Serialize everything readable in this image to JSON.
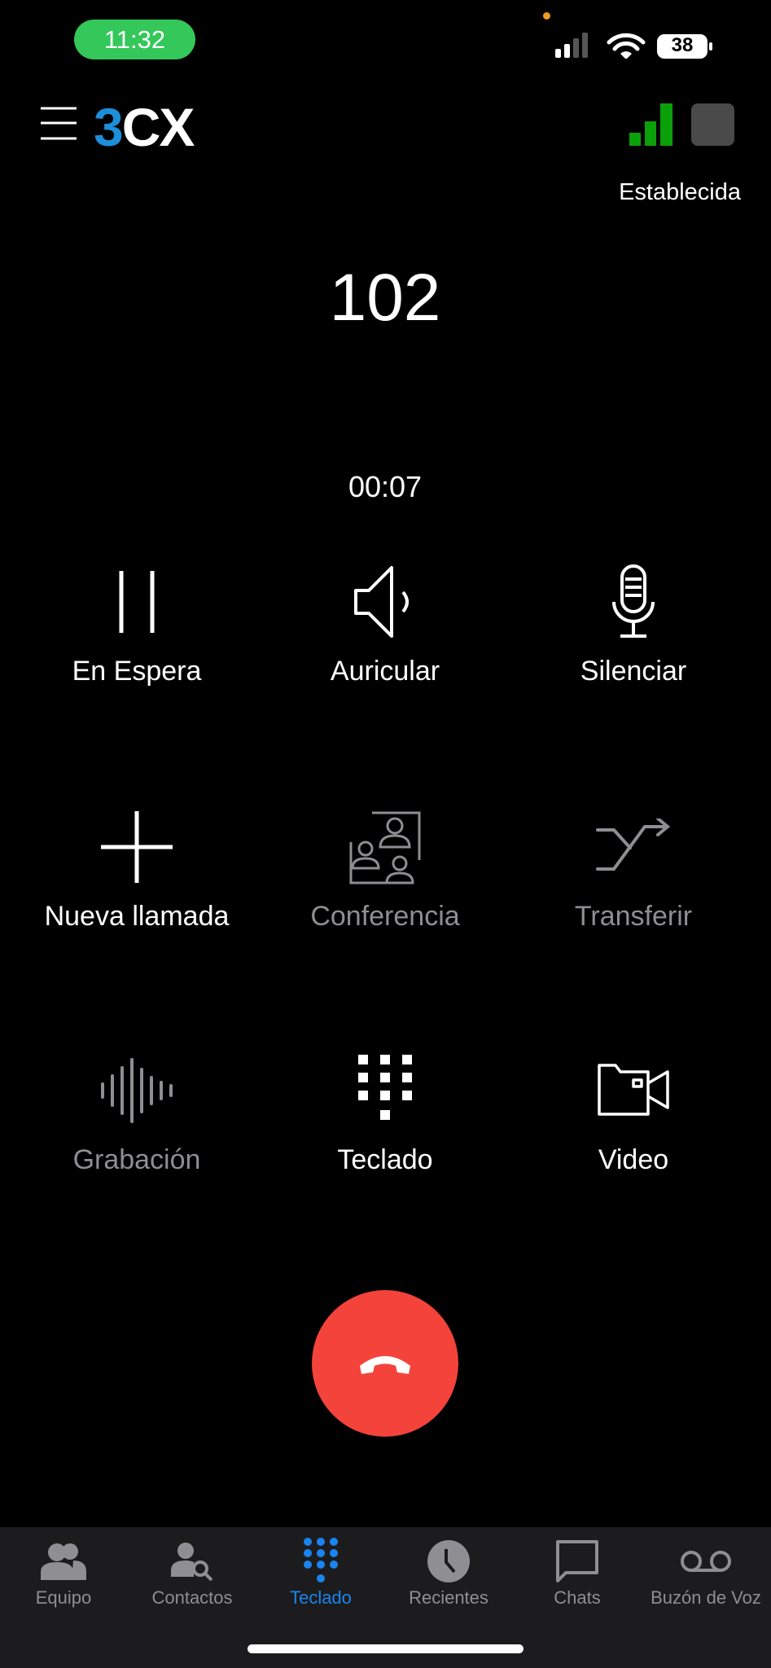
{
  "status_bar": {
    "time": "11:32",
    "battery": "38"
  },
  "header": {
    "logo": "3CX",
    "connection_status": "Establecida"
  },
  "call": {
    "number": "102",
    "duration": "00:07"
  },
  "controls": [
    {
      "label": "En Espera",
      "icon": "pause-icon",
      "enabled": true
    },
    {
      "label": "Auricular",
      "icon": "speaker-icon",
      "enabled": true
    },
    {
      "label": "Silenciar",
      "icon": "microphone-icon",
      "enabled": true
    },
    {
      "label": "Nueva llamada",
      "icon": "plus-icon",
      "enabled": true
    },
    {
      "label": "Conferencia",
      "icon": "conference-icon",
      "enabled": false
    },
    {
      "label": "Transferir",
      "icon": "transfer-icon",
      "enabled": false
    },
    {
      "label": "Grabación",
      "icon": "waveform-icon",
      "enabled": false
    },
    {
      "label": "Teclado",
      "icon": "keypad-icon",
      "enabled": true
    },
    {
      "label": "Video",
      "icon": "video-icon",
      "enabled": true
    }
  ],
  "end_call": {
    "icon": "hangup-icon",
    "color": "#f4433a"
  },
  "tabs": [
    {
      "label": "Equipo",
      "icon": "team-icon"
    },
    {
      "label": "Contactos",
      "icon": "contact-search-icon"
    },
    {
      "label": "Teclado",
      "icon": "keypad-icon",
      "active": true
    },
    {
      "label": "Recientes",
      "icon": "clock-icon"
    },
    {
      "label": "Chats",
      "icon": "chat-icon"
    },
    {
      "label": "Buzón de Voz",
      "icon": "voicemail-icon"
    }
  ],
  "colors": {
    "accent": "#1a84f0",
    "signal": "#0aa00a",
    "status_pill": "#34c759"
  }
}
